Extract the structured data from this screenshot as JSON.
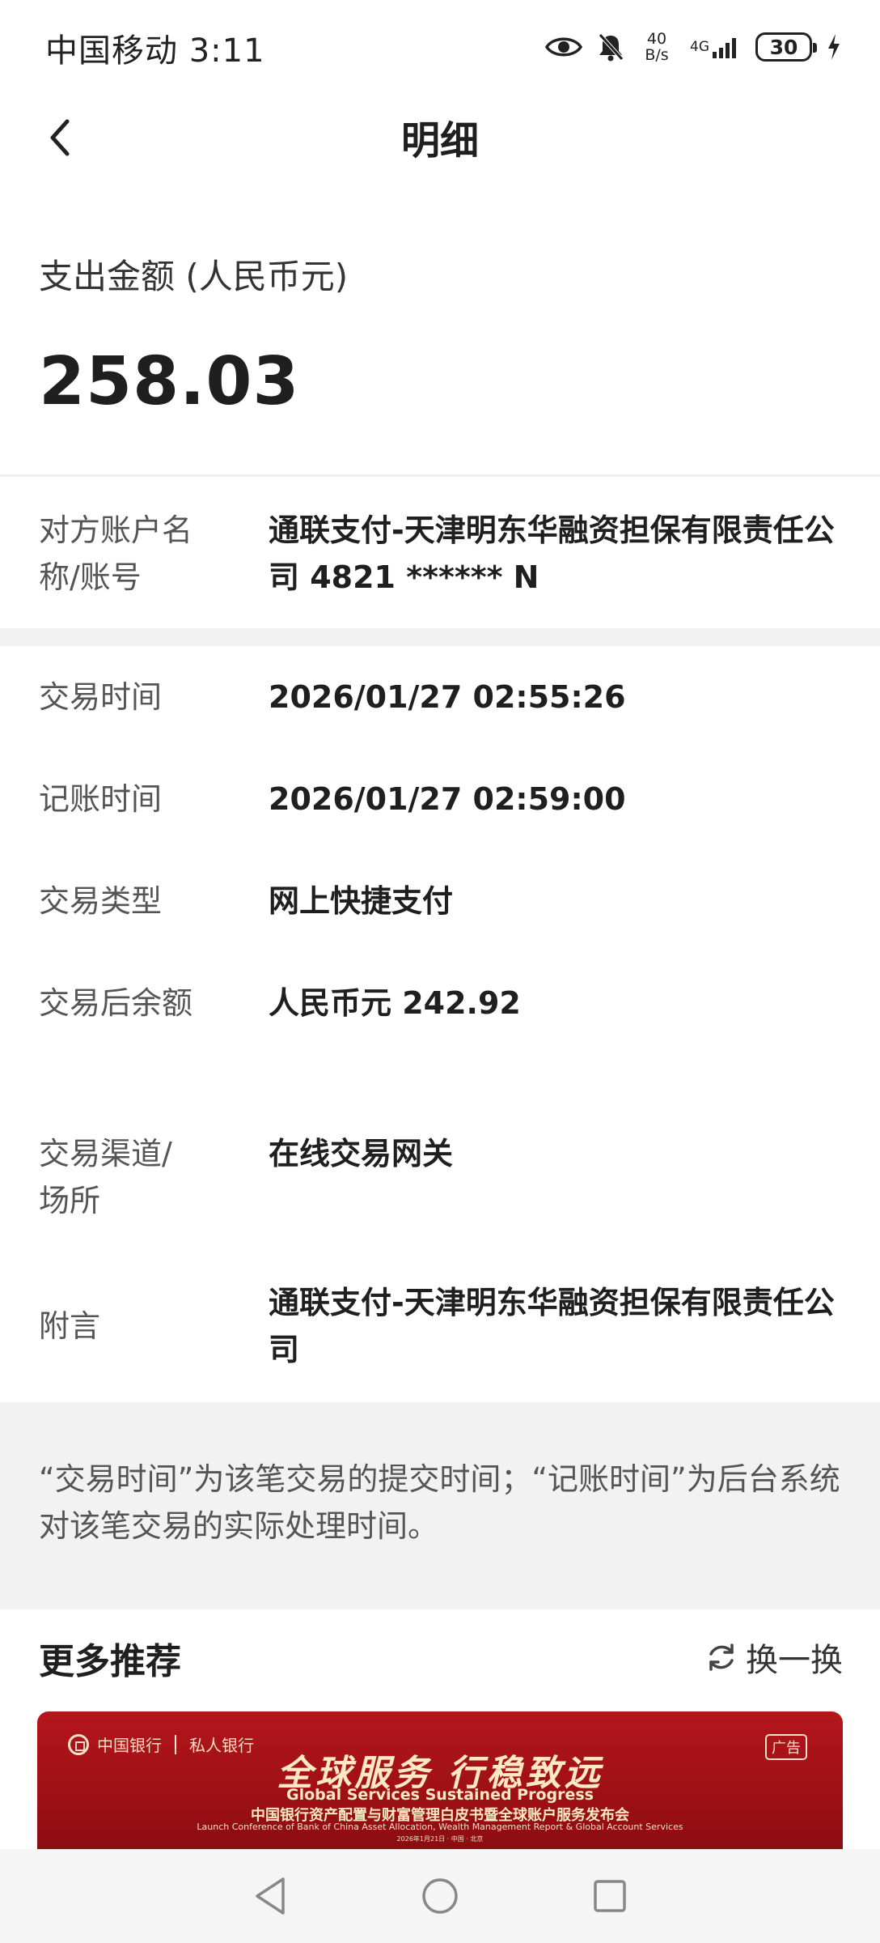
{
  "status_bar": {
    "carrier_time": "中国移动 3:11",
    "net_speed_value": "40",
    "net_speed_unit": "B/s",
    "network_type": "4G",
    "battery": "30"
  },
  "header": {
    "title": "明细"
  },
  "amount": {
    "label": "支出金额 (人民币元)",
    "value": "258.03"
  },
  "counterparty": {
    "label": "对方账户名称/账号",
    "value": "通联支付-天津明东华融资担保有限责任公司 4821 ****** N"
  },
  "details": [
    {
      "label": "交易时间",
      "value": "2026/01/27 02:55:26"
    },
    {
      "label": "记账时间",
      "value": "2026/01/27 02:59:00"
    },
    {
      "label": "交易类型",
      "value": "网上快捷支付"
    },
    {
      "label": "交易后余额",
      "value": "人民币元 242.92"
    },
    {
      "label": "交易渠道/场所",
      "value": "在线交易网关"
    },
    {
      "label": "附言",
      "value": "通联支付-天津明东华融资担保有限责任公司"
    }
  ],
  "note": "“交易时间”为该笔交易的提交时间；“记账时间”为后台系统对该笔交易的实际处理时间。",
  "recommend": {
    "title": "更多推荐",
    "refresh_label": "换一换"
  },
  "banner": {
    "logo_text": "中国银行",
    "logo_text_2": "私人银行",
    "ad_label": "广告",
    "headline": "全球服务 行稳致远",
    "subtitle_en": "Global Services  Sustained Progress",
    "subtitle_cn": "中国银行资产配置与财富管理白皮书暨全球账户服务发布会",
    "subtitle_en_2": "Launch Conference of Bank of China Asset Allocation, Wealth Management Report & Global Account Services",
    "date_line": "2026年1月21日 · 中国 · 北京"
  },
  "colors": {
    "banner_red": "#a3131a",
    "banner_gold": "#ffe9c2",
    "band_gray": "#f2f2f2"
  }
}
